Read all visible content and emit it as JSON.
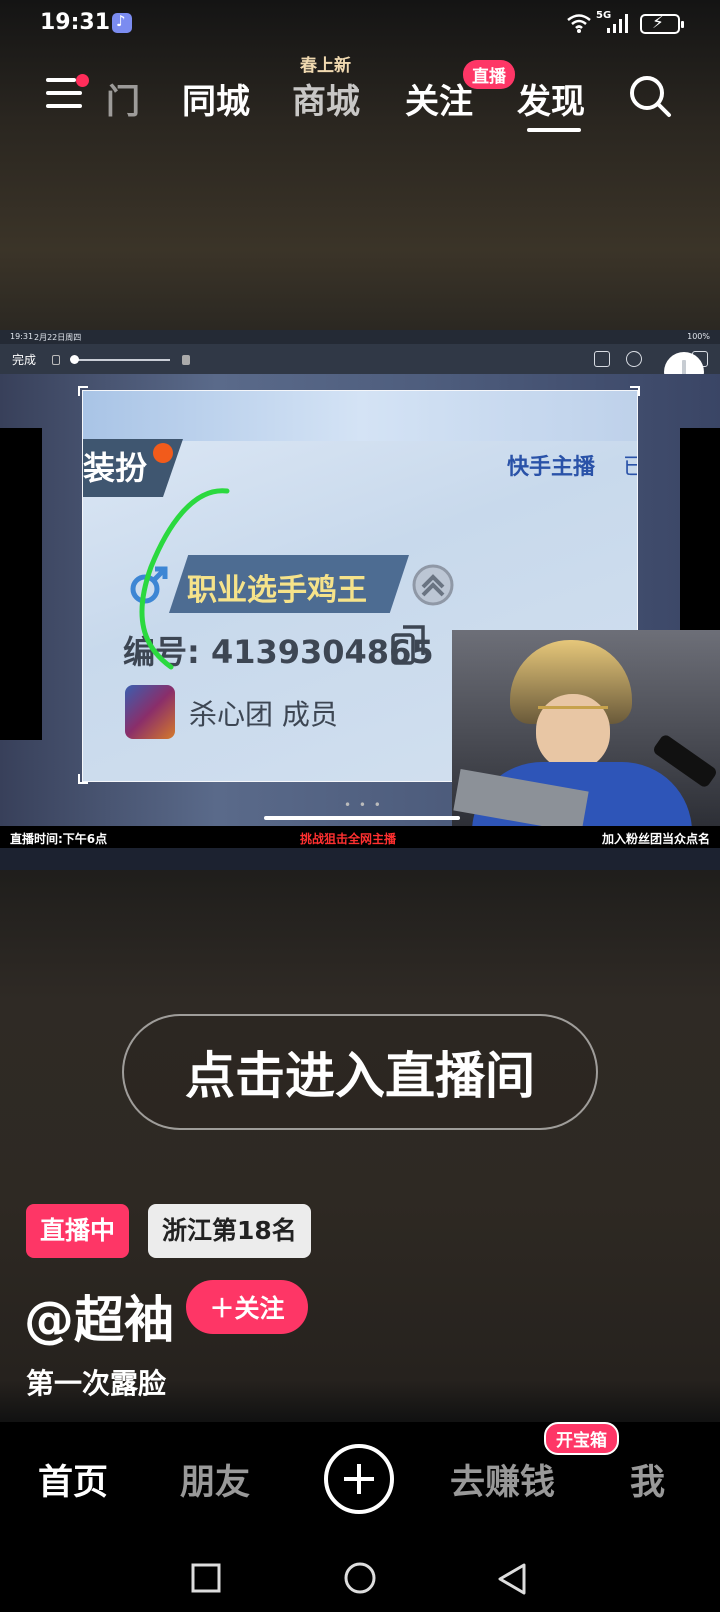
{
  "status_bar": {
    "time": "19:31",
    "network": "5G"
  },
  "nav": {
    "tabs": [
      "门",
      "同城",
      "商城",
      "关注",
      "发现"
    ],
    "active_tab": "发现",
    "mall_tag": "春上新",
    "follow_badge": "直播"
  },
  "video": {
    "ipad_time": "19:31",
    "ipad_date": "2月22日周四",
    "ipad_status": "100%",
    "done_label": "完成",
    "card": {
      "dress_label": "装扮",
      "anchor_label": "快手主播",
      "anchor_tail": "已",
      "player_title": "职业选手鸡王",
      "player_id": "编号: 4139304865",
      "guild": "杀心团 成员"
    },
    "caption_left": "直播时间:下午6点",
    "caption_middle": "挑战狙击全网主播",
    "caption_right": "加入粉丝团当众点名"
  },
  "enter_button": "点击进入直播间",
  "info": {
    "live_badge": "直播中",
    "rank_badge": "浙江第18名",
    "author": "@超袖",
    "follow_button": "＋关注",
    "description": "第一次露脸"
  },
  "bottom_nav": {
    "home": "首页",
    "friends": "朋友",
    "earn": "去赚钱",
    "earn_badge": "开宝箱",
    "me": "我"
  },
  "colors": {
    "accent": "#fe3666",
    "card_title": "#f6e38a",
    "anchor": "#2a52a8"
  },
  "icons": [
    "menu-icon",
    "search-icon",
    "music-icon",
    "wifi-icon",
    "signal-icon",
    "battery-icon",
    "male-icon",
    "rank-icon",
    "copy-icon",
    "plus-icon",
    "square-icon",
    "circle-icon",
    "back-icon"
  ]
}
